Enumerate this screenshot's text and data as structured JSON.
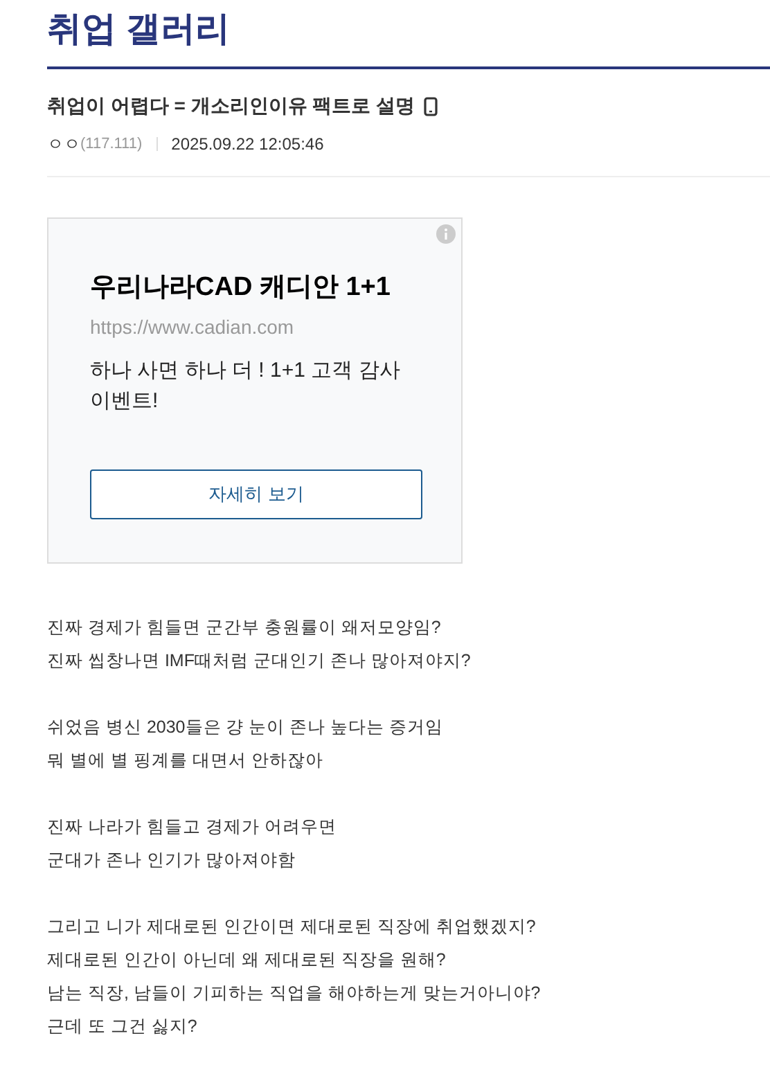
{
  "gallery_title": "취업 갤러리",
  "post": {
    "title": "취업이 어렵다 = 개소리인이유 팩트로 설명",
    "author": "ㅇㅇ",
    "ip": "(117.111)",
    "date": "2025.09.22 12:05:46"
  },
  "ad": {
    "title": "우리나라CAD 캐디안 1+1",
    "url": "https://www.cadian.com",
    "description": "하나 사면 하나 더 ! 1+1 고객 감사 이벤트!",
    "button": "자세히 보기"
  },
  "body": [
    [
      "진짜 경제가 힘들면 군간부 충원률이 왜저모양임?",
      "진짜 씹창나면 IMF때처럼 군대인기 존나 많아져야지?"
    ],
    [
      "쉬었음 병신 2030들은 걍 눈이 존나 높다는 증거임",
      "뭐 별에 별 핑계를 대면서 안하잖아"
    ],
    [
      "진짜 나라가 힘들고 경제가 어려우면",
      "군대가 존나 인기가 많아져야함"
    ],
    [
      "그리고 니가 제대로된 인간이면 제대로된 직장에 취업했겠지?",
      "제대로된 인간이 아닌데 왜 제대로된 직장을 원해?",
      "남는 직장, 남들이 기피하는 직업을 해야하는게 맞는거아니야?",
      "근데 또 그건 싫지?"
    ]
  ]
}
